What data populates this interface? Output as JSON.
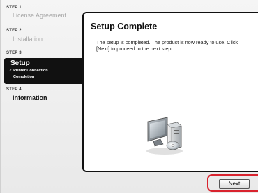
{
  "sidebar": {
    "steps": [
      {
        "number": "STEP 1",
        "title": "License Agreement"
      },
      {
        "number": "STEP 2",
        "title": "Installation"
      },
      {
        "number": "STEP 3",
        "title": "Setup",
        "substeps": [
          "✓ Printer Connection",
          "Completion"
        ]
      },
      {
        "number": "STEP 4",
        "title": "Information"
      }
    ]
  },
  "main": {
    "title": "Setup Complete",
    "description": "The setup is completed. The product is now ready to use. Click [Next] to proceed to the next step.",
    "illustration_icon": "computer-with-cd-icon"
  },
  "footer": {
    "next_label": "Next",
    "highlight_color": "#d9232e"
  }
}
